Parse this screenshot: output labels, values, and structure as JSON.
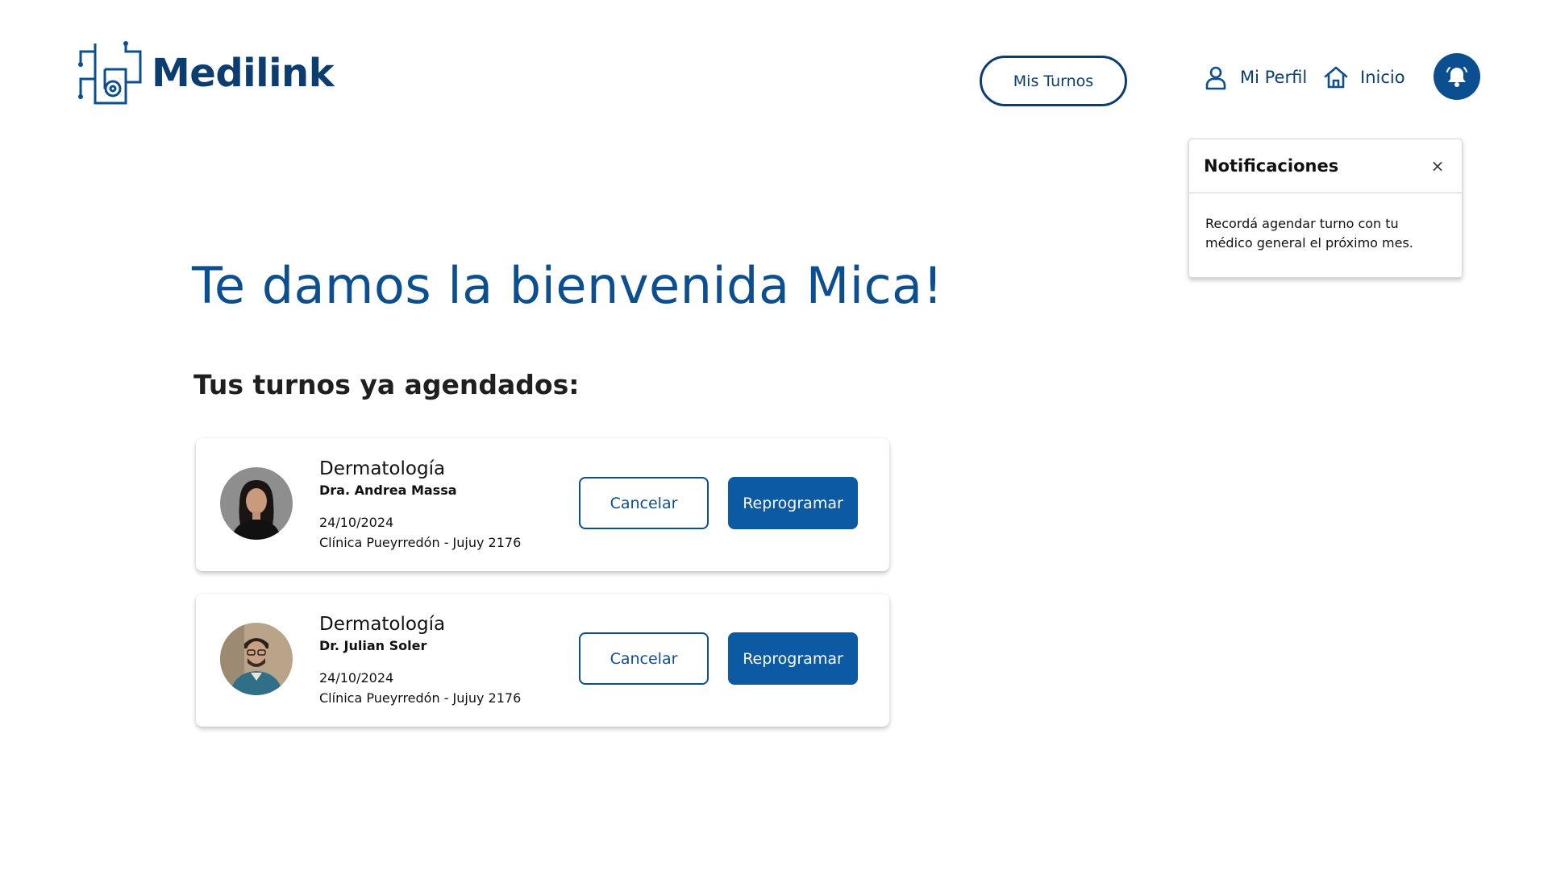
{
  "brand": {
    "name": "Medilink",
    "color": "#0b3d70"
  },
  "header": {
    "mis_turnos": "Mis Turnos",
    "mi_perfil": "Mi Perfil",
    "inicio": "Inicio"
  },
  "notifications": {
    "title": "Notificaciones",
    "close": "×",
    "message": "Recordá agendar turno con tu médico general el próximo mes."
  },
  "welcome": "Te damos la bienvenida Mica!",
  "appointments_heading": "Tus turnos ya agendados:",
  "appointments": [
    {
      "specialty": "Dermatología",
      "doctor": "Dra. Andrea Massa",
      "date": "24/10/2024",
      "place": "Clínica Pueyrredón - Jujuy 2176",
      "cancel": "Cancelar",
      "reschedule": "Reprogramar"
    },
    {
      "specialty": "Dermatología",
      "doctor": "Dr. Julian Soler",
      "date": "24/10/2024",
      "place": "Clínica Pueyrredón - Jujuy 2176",
      "cancel": "Cancelar",
      "reschedule": "Reprogramar"
    }
  ],
  "colors": {
    "primary": "#0b4f91",
    "button_fill": "#0b5aa3",
    "dark": "#0b3d70"
  },
  "icons": [
    "medilink-logo-icon",
    "user-icon",
    "home-icon",
    "bell-icon",
    "close-icon"
  ]
}
